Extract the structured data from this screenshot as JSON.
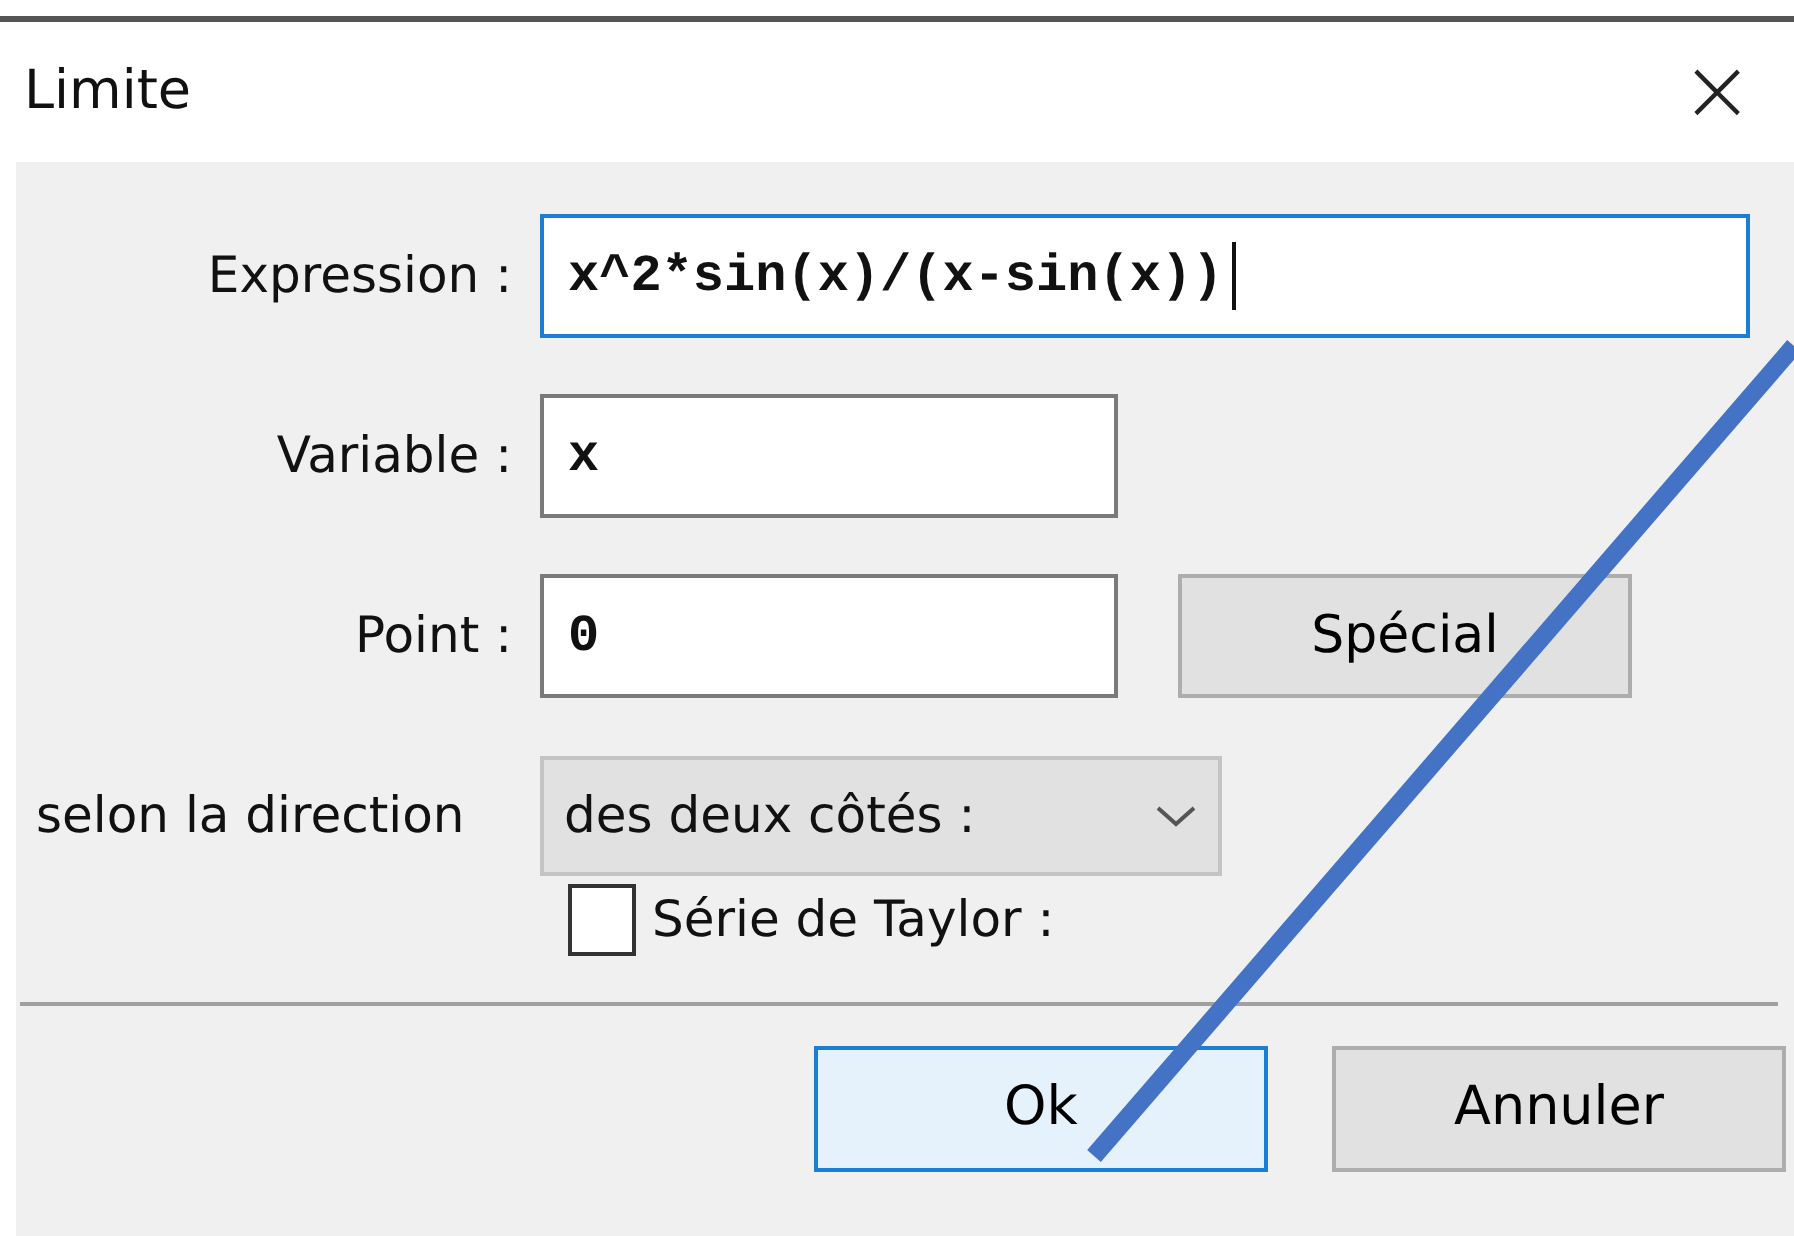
{
  "window": {
    "title": "Limite",
    "close": "×"
  },
  "fields": [
    {
      "kind": "text",
      "label": "Expression :",
      "value": "x^2*sin(x)/(x-sin(x))",
      "focused": true,
      "wide": true
    },
    {
      "kind": "text",
      "label": "Variable :",
      "value": "x",
      "focused": false,
      "wide": false
    },
    {
      "kind": "text",
      "label": "Point :",
      "value": "0",
      "focused": false,
      "wide": false,
      "button": "Spécial"
    },
    {
      "kind": "select",
      "label": "selon la direction",
      "value": "des deux côtés :"
    },
    {
      "kind": "checkbox",
      "label": "Série de Taylor :",
      "checked": false
    }
  ],
  "buttons": [
    {
      "label": "Ok",
      "default": true
    },
    {
      "label": "Annuler",
      "default": false
    }
  ]
}
